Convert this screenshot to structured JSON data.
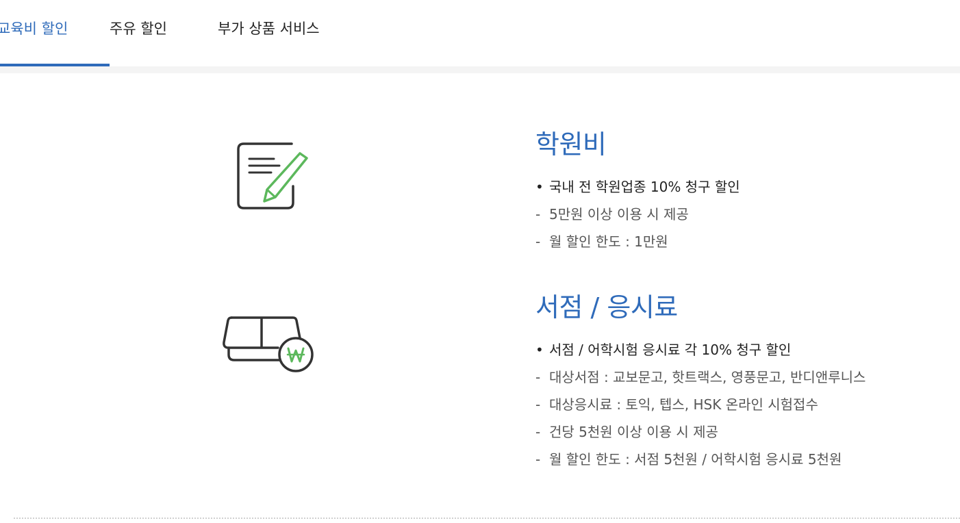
{
  "tabs": [
    {
      "label": "교육비 할인",
      "active": true
    },
    {
      "label": "주유 할인",
      "active": false
    },
    {
      "label": "부가 상품 서비스",
      "active": false
    }
  ],
  "sections": [
    {
      "title": "학원비",
      "icon": "document-pen-icon",
      "items": [
        {
          "marker": "•",
          "text": "국내 전 학원업종 10% 청구 할인"
        },
        {
          "marker": "-",
          "text": "5만원 이상 이용 시 제공"
        },
        {
          "marker": "-",
          "text": "월 할인 한도 : 1만원"
        }
      ]
    },
    {
      "title": "서점 / 응시료",
      "icon": "book-won-icon",
      "items": [
        {
          "marker": "•",
          "text": "서점 / 어학시험 응시료 각 10% 청구 할인"
        },
        {
          "marker": "-",
          "text": "대상서점 : 교보문고, 핫트랙스, 영풍문고, 반디앤루니스"
        },
        {
          "marker": "-",
          "text": "대상응시료 : 토익, 텝스, HSK 온라인 시험접수"
        },
        {
          "marker": "-",
          "text": "건당 5천원 이상 이용 시 제공"
        },
        {
          "marker": "-",
          "text": "월 할인 한도 : 서점 5천원 / 어학시험 응시료 5천원"
        }
      ]
    }
  ],
  "colors": {
    "accent": "#2f6bba",
    "icon_stroke": "#333333",
    "icon_green": "#5cb85c"
  }
}
